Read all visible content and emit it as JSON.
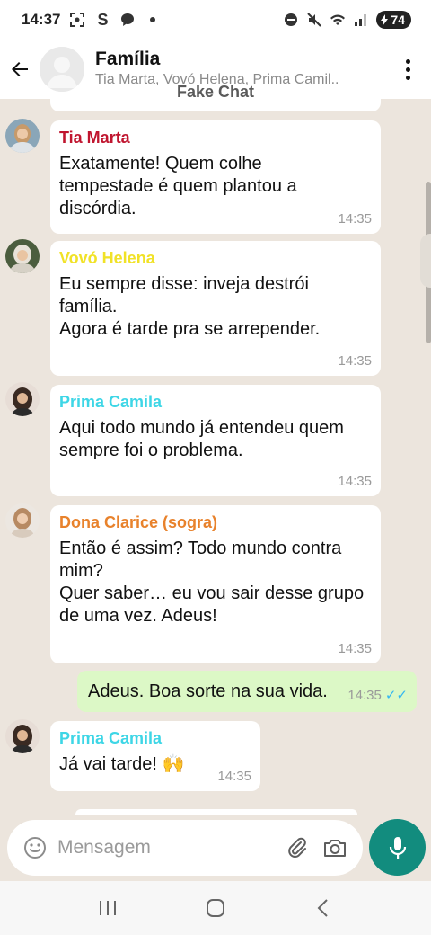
{
  "status_bar": {
    "time": "14:37",
    "battery": "74",
    "left_icons": [
      "screenshot-icon",
      "s-icon",
      "message-icon",
      "dot-icon"
    ],
    "right_icons": [
      "dnd-icon",
      "mute-icon",
      "wifi-icon",
      "signal-icon"
    ]
  },
  "header": {
    "title": "Família",
    "subtitle": "Tia Marta, Vovó Helena, Prima Camil..",
    "watermark": "Fake Chat"
  },
  "messages": [
    {
      "sender": "Tia Marta",
      "sender_color": "#c0152f",
      "lines": [
        "Exatamente! Quem colhe",
        "tempestade é quem plantou a",
        "discórdia."
      ],
      "time": "14:35"
    },
    {
      "sender": "Vovó Helena",
      "sender_color": "#f1e227",
      "lines": [
        "Eu sempre disse: inveja destrói",
        "família.",
        "Agora é tarde pra se arrepender."
      ],
      "time": "14:35"
    },
    {
      "sender": "Prima Camila",
      "sender_color": "#3ed6e6",
      "lines": [
        "Aqui todo mundo já entendeu quem",
        "sempre foi o problema."
      ],
      "time": "14:35"
    },
    {
      "sender": "Dona Clarice (sogra)",
      "sender_color": "#e8822c",
      "lines": [
        "Então é assim? Todo mundo contra",
        "mim?",
        "Quer saber… eu vou sair desse grupo",
        "de uma vez. Adeus!"
      ],
      "time": "14:35"
    },
    {
      "outgoing": true,
      "text": "Adeus. Boa sorte na sua vida.",
      "time": "14:35",
      "ticks": "✓✓"
    },
    {
      "sender": "Prima Camila",
      "sender_color": "#3ed6e6",
      "text": "Já vai tarde! 🙌",
      "time": "14:35"
    }
  ],
  "composer": {
    "placeholder": "Mensagem"
  },
  "colors": {
    "chat_bg": "#ece5dd",
    "outgoing_bubble": "#dcf8c6",
    "accent": "#128c7e",
    "read_ticks": "#34b7f1"
  }
}
